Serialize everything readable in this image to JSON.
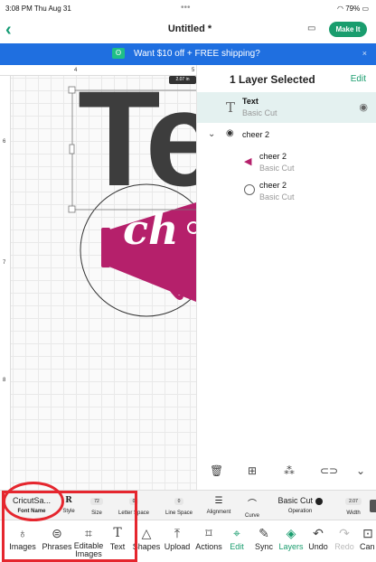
{
  "status_bar": {
    "time": "3:08 PM  Thu Aug 31",
    "dots": "•••",
    "battery": "79%"
  },
  "header": {
    "back_icon": "chevron-left-icon",
    "title": "Untitled *",
    "calendar_icon": "calendar-icon",
    "make_it": "Make It"
  },
  "banner": {
    "tag_icon": "promo-tag-icon",
    "text": "Want $10 off + FREE shipping?",
    "close": "×"
  },
  "canvas": {
    "ruler_top": [
      "4",
      "5"
    ],
    "ruler_left": [
      "6",
      "7",
      "8"
    ],
    "dimension_badge": "2.07 in",
    "artwork_text": "Te",
    "artwork_script": "ch"
  },
  "layers_panel": {
    "title": "1 Layer Selected",
    "edit": "Edit",
    "items": [
      {
        "name": "Text",
        "subtitle": "Basic Cut",
        "icon": "text-T-icon",
        "action_icon": "eye-icon"
      },
      {
        "name": "cheer 2",
        "icon": "megaphone-icon",
        "chevron": "chevron-down-icon"
      },
      {
        "name": "cheer 2",
        "subtitle": "Basic Cut",
        "icon": "megaphone-thumbnail-icon"
      },
      {
        "name": "cheer 2",
        "subtitle": "Basic Cut",
        "icon": "circle-outline-icon"
      }
    ],
    "tools": [
      "trash-icon",
      "duplicate-icon",
      "group-icon",
      "attach-icon",
      "combine-icon"
    ]
  },
  "properties": {
    "font_name": {
      "value": "CricutSa...",
      "label": "Font Name"
    },
    "style": {
      "value": "R",
      "label": "Style"
    },
    "size": {
      "value": "72",
      "label": "Size"
    },
    "letter_space": {
      "value": "0",
      "label": "Letter Space"
    },
    "line_space": {
      "value": "0",
      "label": "Line Space"
    },
    "alignment": {
      "label": "Alignment"
    },
    "curve": {
      "label": "Curve"
    },
    "operation": {
      "value": "Basic Cut",
      "label": "Operation"
    },
    "width": {
      "value": "2.07",
      "label": "Width"
    }
  },
  "toolbar": [
    {
      "label": "Images",
      "icon": "lightbulb-icon"
    },
    {
      "label": "Phrases",
      "icon": "speech-bubble-icon"
    },
    {
      "label": "Editable\nImages",
      "icon": "editable-image-icon"
    },
    {
      "label": "Text",
      "icon": "text-T-icon"
    },
    {
      "label": "Shapes",
      "icon": "shapes-icon"
    },
    {
      "label": "Upload",
      "icon": "upload-icon"
    },
    {
      "label": "Actions",
      "icon": "actions-icon"
    },
    {
      "label": "Edit",
      "icon": "edit-icon"
    },
    {
      "label": "Sync",
      "icon": "sync-brush-icon"
    },
    {
      "label": "Layers",
      "icon": "layers-icon"
    },
    {
      "label": "Undo",
      "icon": "undo-icon"
    },
    {
      "label": "Redo",
      "icon": "redo-icon"
    },
    {
      "label": "Can",
      "icon": "canvas-icon"
    }
  ],
  "colors": {
    "accent": "#1a9d6e",
    "banner": "#1f6fe0",
    "annotation": "#e5262e",
    "artwork_magenta": "#b5206b",
    "artwork_dark": "#3d3d3d"
  }
}
